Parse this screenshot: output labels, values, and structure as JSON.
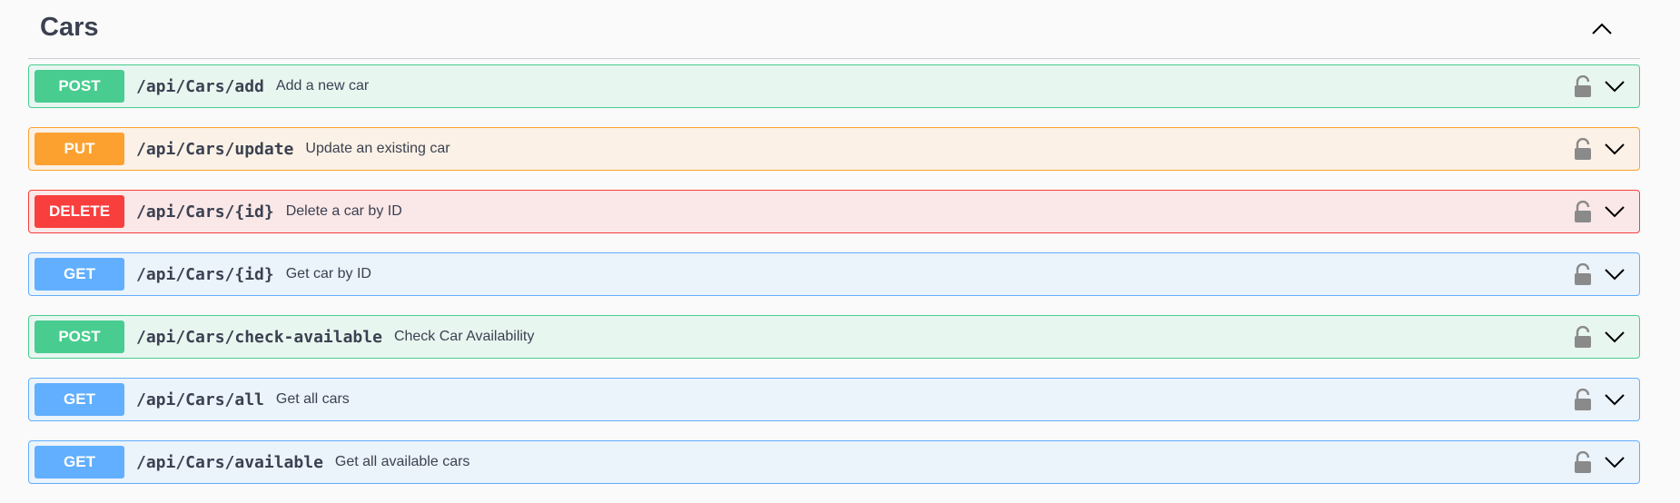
{
  "section": {
    "title": "Cars",
    "collapse_icon": "chevron-up-icon"
  },
  "colors": {
    "post": "#49cc90",
    "put": "#fca130",
    "delete": "#f93e3e",
    "get": "#61affe"
  },
  "operations": [
    {
      "method": "POST",
      "path": "/api/Cars/add",
      "summary": "Add a new car"
    },
    {
      "method": "PUT",
      "path": "/api/Cars/update",
      "summary": "Update an existing car"
    },
    {
      "method": "DELETE",
      "path": "/api/Cars/{id}",
      "summary": "Delete a car by ID"
    },
    {
      "method": "GET",
      "path": "/api/Cars/{id}",
      "summary": "Get car by ID"
    },
    {
      "method": "POST",
      "path": "/api/Cars/check-available",
      "summary": "Check Car Availability"
    },
    {
      "method": "GET",
      "path": "/api/Cars/all",
      "summary": "Get all cars"
    },
    {
      "method": "GET",
      "path": "/api/Cars/available",
      "summary": "Get all available cars"
    }
  ],
  "icons": {
    "lock": "unlock-icon",
    "expand": "chevron-down-icon"
  }
}
